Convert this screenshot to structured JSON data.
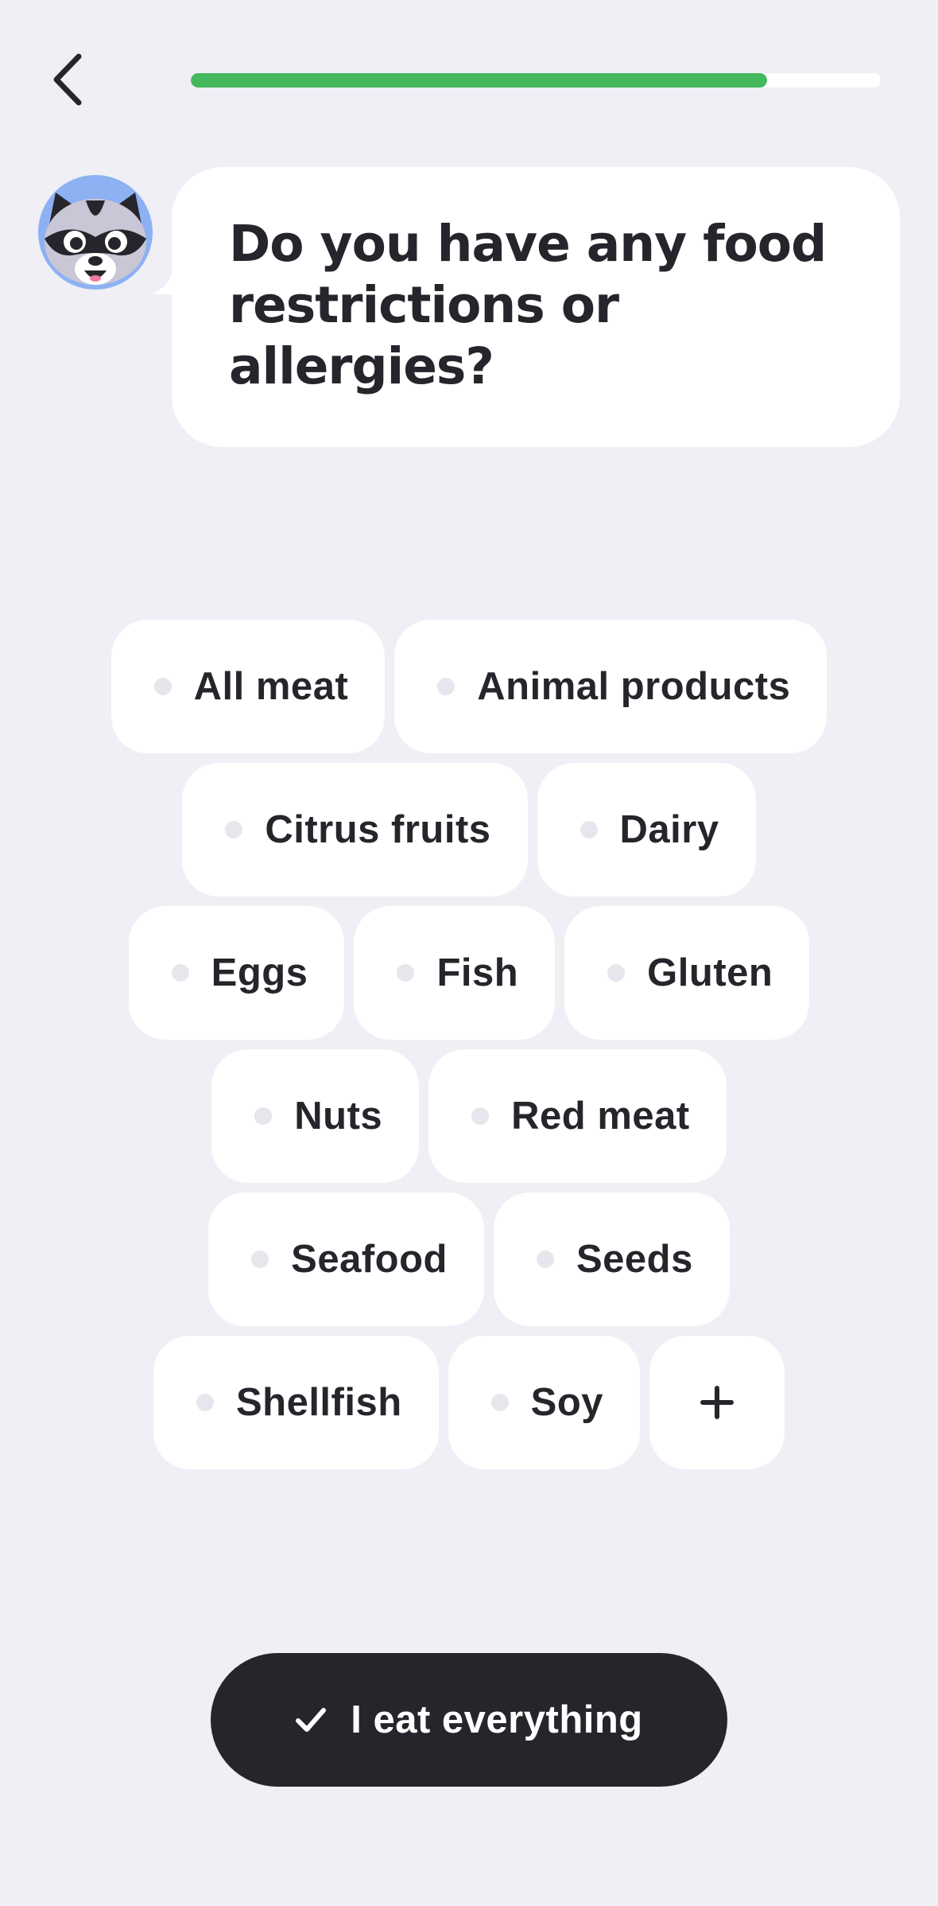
{
  "header": {
    "back_icon": "chevron-left-icon",
    "progress": 0.835,
    "progress_color": "#45b75d"
  },
  "question": {
    "text": "Do you have any food restrictions or allergies?",
    "avatar_icon": "raccoon-avatar-icon",
    "avatar_bg": "#8db1f2"
  },
  "options": [
    [
      "All meat",
      "Animal products"
    ],
    [
      "Citrus fruits",
      "Dairy"
    ],
    [
      "Eggs",
      "Fish",
      "Gluten"
    ],
    [
      "Nuts",
      "Red meat"
    ],
    [
      "Seafood",
      "Seeds"
    ],
    [
      "Shellfish",
      "Soy"
    ]
  ],
  "add_option_icon": "plus-icon",
  "cta": {
    "label": "I eat everything",
    "icon": "check-icon"
  }
}
